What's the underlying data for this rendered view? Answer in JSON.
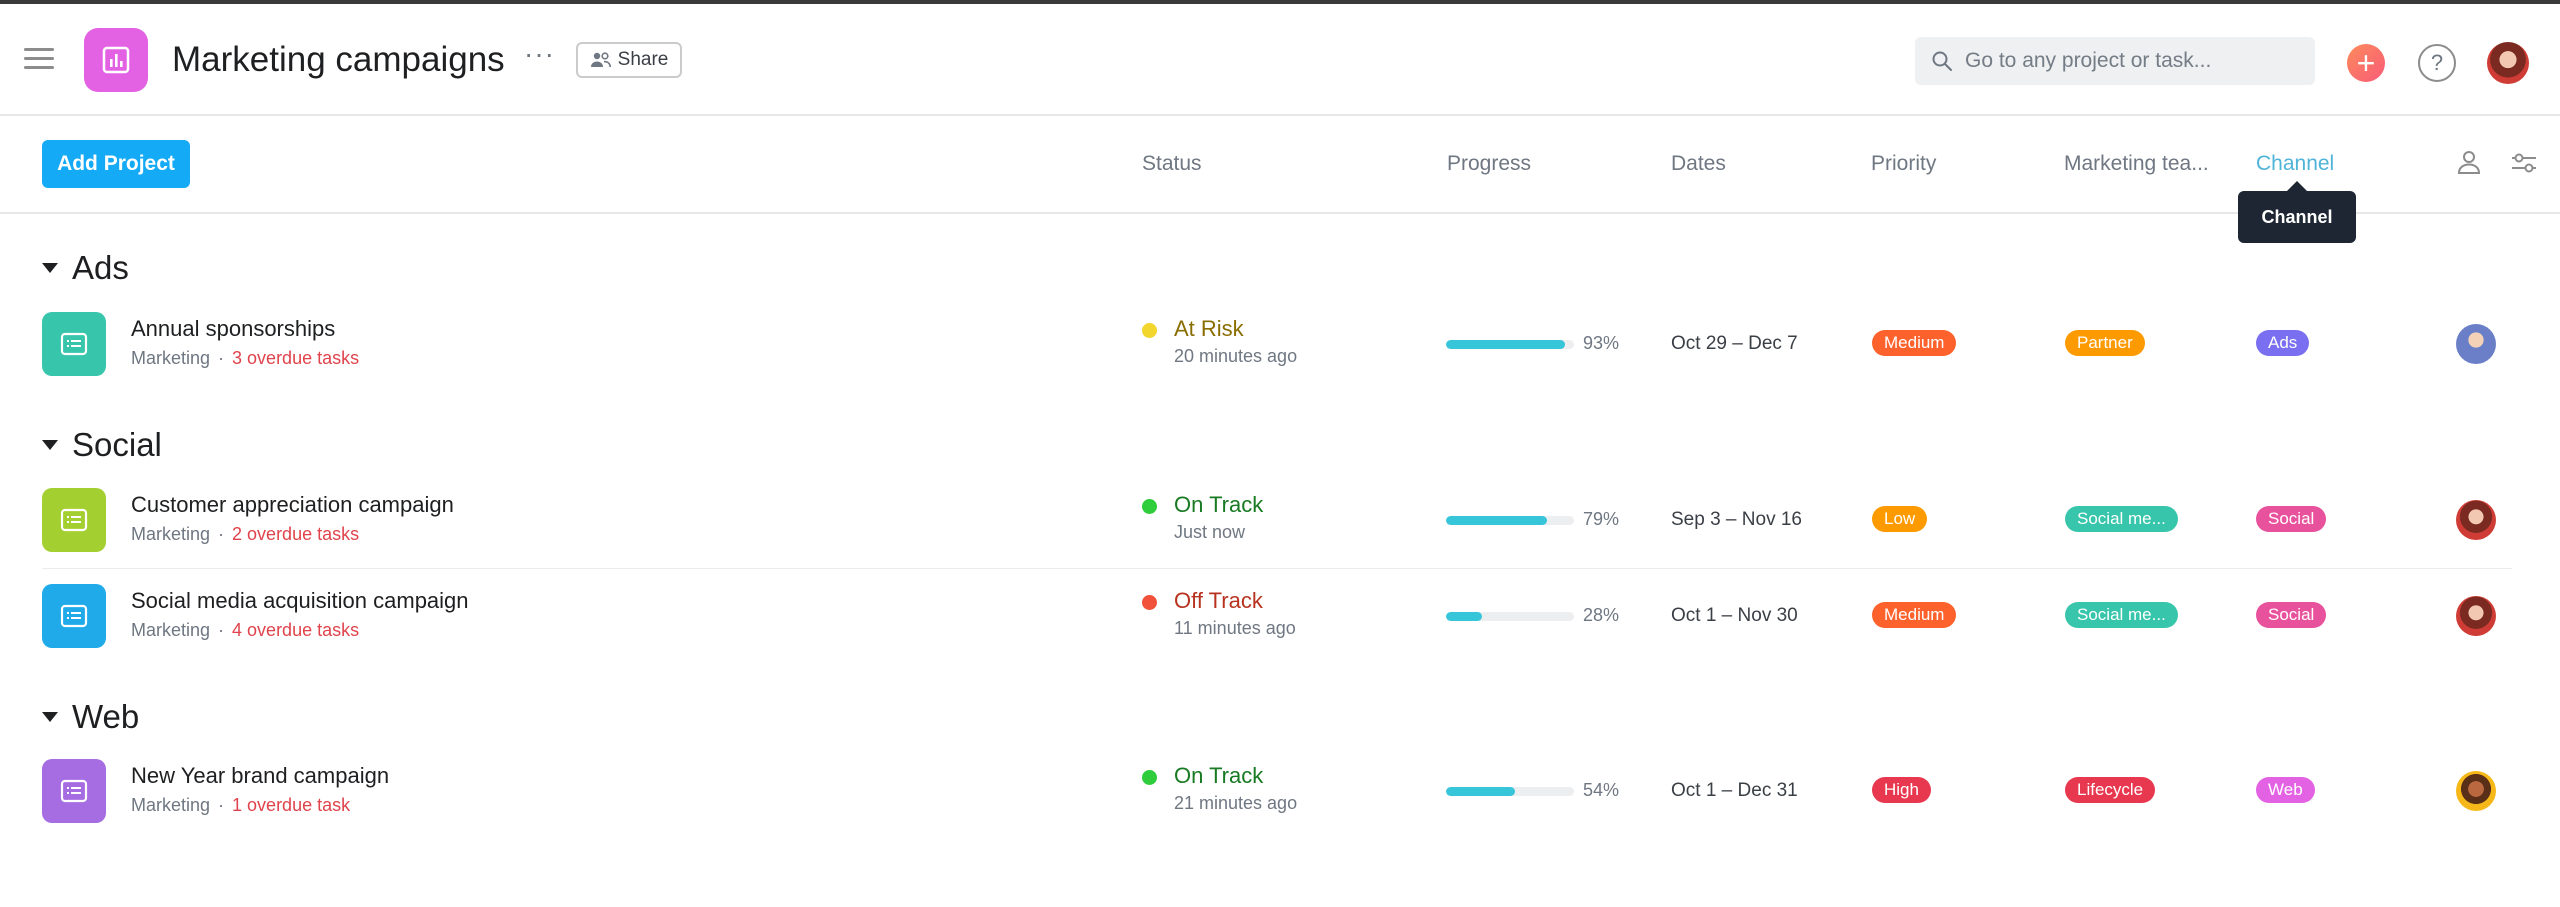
{
  "header": {
    "title": "Marketing campaigns",
    "more": "···",
    "share_label": "Share",
    "search_placeholder": "Go to any project or task...",
    "plus": "+",
    "help": "?"
  },
  "columns": {
    "add_project": "Add Project",
    "status": "Status",
    "progress": "Progress",
    "dates": "Dates",
    "priority": "Priority",
    "marketing_team": "Marketing tea...",
    "channel": "Channel"
  },
  "tooltip": "Channel",
  "sections": [
    {
      "name": "Ads",
      "rows": [
        {
          "name": "Annual sponsorships",
          "team": "Marketing",
          "sep": "·",
          "overdue": "3 overdue tasks",
          "icon_color": "#37c5ab",
          "status": "At Risk",
          "status_color": "#f2d62e",
          "status_text_color": "#8a6d00",
          "status_time": "20 minutes ago",
          "progress": 0.93,
          "progress_label": "93%",
          "dates": "Oct 29 – Dec 7",
          "priority": "Medium",
          "priority_color": "#fd612c",
          "marketing_team": "Partner",
          "team_color": "#fd9a00",
          "channel": "Ads",
          "channel_color": "#7a6ff0",
          "avatar": "avatar-1"
        }
      ]
    },
    {
      "name": "Social",
      "rows": [
        {
          "name": "Customer appreciation campaign",
          "team": "Marketing",
          "sep": "·",
          "overdue": "2 overdue tasks",
          "icon_color": "#a4cf30",
          "status": "On Track",
          "status_color": "#2fcc3b",
          "status_text_color": "#187a22",
          "status_time": "Just now",
          "progress": 0.79,
          "progress_label": "79%",
          "dates": "Sep 3 – Nov 16",
          "priority": "Low",
          "priority_color": "#fd9a00",
          "marketing_team": "Social me...",
          "team_color": "#37c5ab",
          "channel": "Social",
          "channel_color": "#e8519c",
          "avatar": "avatar-2"
        },
        {
          "name": "Social media acquisition campaign",
          "team": "Marketing",
          "sep": "·",
          "overdue": "4 overdue tasks",
          "icon_color": "#20aaea",
          "status": "Off Track",
          "status_color": "#f1513a",
          "status_text_color": "#b7331f",
          "status_time": "11 minutes ago",
          "progress": 0.28,
          "progress_label": "28%",
          "dates": "Oct 1 – Nov 30",
          "priority": "Medium",
          "priority_color": "#fd612c",
          "marketing_team": "Social me...",
          "team_color": "#37c5ab",
          "channel": "Social",
          "channel_color": "#e8519c",
          "avatar": "avatar-2"
        }
      ]
    },
    {
      "name": "Web",
      "rows": [
        {
          "name": "New Year brand campaign",
          "team": "Marketing",
          "sep": "·",
          "overdue": "1 overdue task",
          "icon_color": "#a66de2",
          "status": "On Track",
          "status_color": "#2fcc3b",
          "status_text_color": "#187a22",
          "status_time": "21 minutes ago",
          "progress": 0.54,
          "progress_label": "54%",
          "dates": "Oct 1 – Dec 31",
          "priority": "High",
          "priority_color": "#e8384f",
          "marketing_team": "Lifecycle",
          "team_color": "#e8384f",
          "channel": "Web",
          "channel_color": "#e362e3",
          "avatar": "avatar-3"
        }
      ]
    }
  ],
  "icons": {
    "menu": "hamburger-icon",
    "project": "bar-chart-icon",
    "share": "people-icon",
    "search": "search-icon",
    "row": "list-icon",
    "assignee": "person-icon",
    "filter": "sliders-icon"
  },
  "colors": {
    "accent": "#14aaf5",
    "project_icon": "#e362e3",
    "active_column": "#4fb4d8",
    "progress_fill": "#37c5d9"
  }
}
